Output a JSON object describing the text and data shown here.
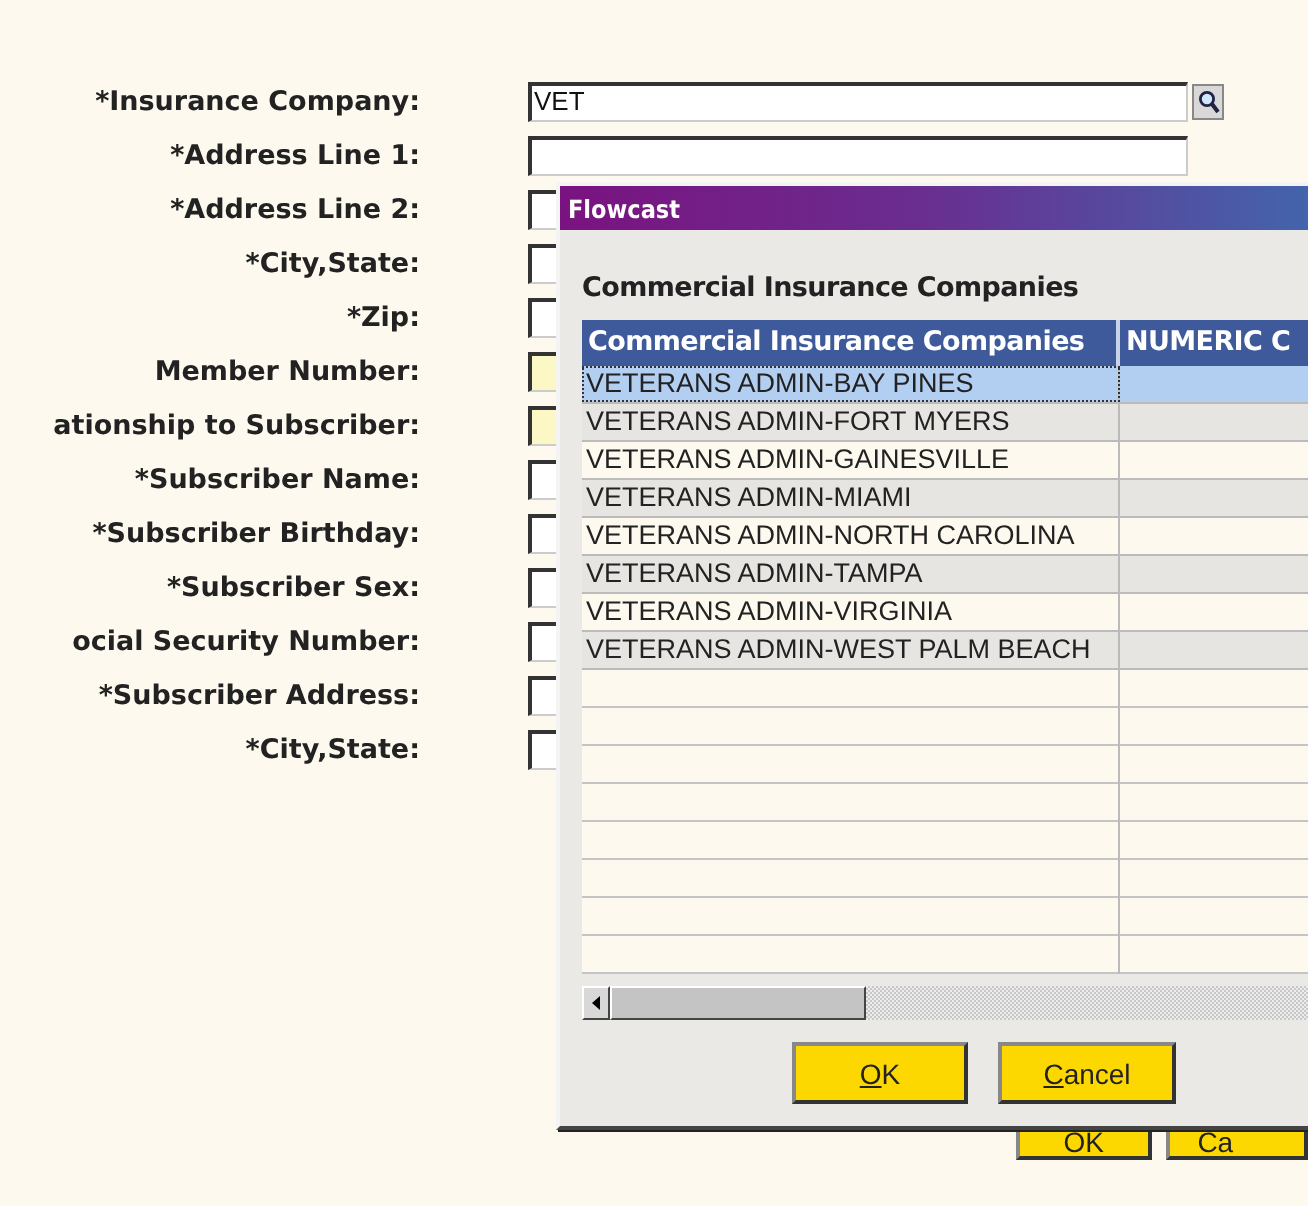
{
  "form": {
    "fields": [
      {
        "label": "*Insurance Company:",
        "kind": "search",
        "value": "VET",
        "highlighted": false
      },
      {
        "label": "*Address Line 1:",
        "kind": "text",
        "highlighted": false
      },
      {
        "label": "*Address Line 2:",
        "kind": "text",
        "highlighted": false
      },
      {
        "label": "*City,State:",
        "kind": "text",
        "highlighted": false
      },
      {
        "label": "*Zip:",
        "kind": "text",
        "highlighted": false
      },
      {
        "label": "Member Number:",
        "kind": "text",
        "highlighted": true
      },
      {
        "label": "ationship to Subscriber:",
        "kind": "text",
        "highlighted": true
      },
      {
        "label": "*Subscriber Name:",
        "kind": "text",
        "highlighted": false
      },
      {
        "label": "*Subscriber Birthday:",
        "kind": "text",
        "highlighted": false
      },
      {
        "label": "*Subscriber Sex:",
        "kind": "text",
        "highlighted": false
      },
      {
        "label": "ocial Security Number:",
        "kind": "text",
        "highlighted": false
      },
      {
        "label": "*Subscriber Address:",
        "kind": "text",
        "highlighted": false
      },
      {
        "label": "*City,State:",
        "kind": "text",
        "highlighted": false
      }
    ],
    "buttons": [
      {
        "label": "OK"
      },
      {
        "label": "Ca"
      }
    ]
  },
  "dialog": {
    "title": "Flowcast",
    "heading": "Commercial Insurance Companies",
    "table": {
      "columns": [
        "Commercial Insurance Companies",
        "NUMERIC C"
      ],
      "rows": [
        {
          "name": "VETERANS ADMIN-BAY PINES",
          "selected": true
        },
        {
          "name": "VETERANS ADMIN-FORT MYERS",
          "selected": false
        },
        {
          "name": "VETERANS ADMIN-GAINESVILLE",
          "selected": false
        },
        {
          "name": "VETERANS ADMIN-MIAMI",
          "selected": false
        },
        {
          "name": "VETERANS ADMIN-NORTH CAROLINA",
          "selected": false
        },
        {
          "name": "VETERANS ADMIN-TAMPA",
          "selected": false
        },
        {
          "name": "VETERANS ADMIN-VIRGINIA",
          "selected": false
        },
        {
          "name": "VETERANS ADMIN-WEST PALM BEACH",
          "selected": false
        }
      ]
    },
    "buttons": [
      {
        "label": "OK"
      },
      {
        "label": "Cancel"
      }
    ]
  }
}
